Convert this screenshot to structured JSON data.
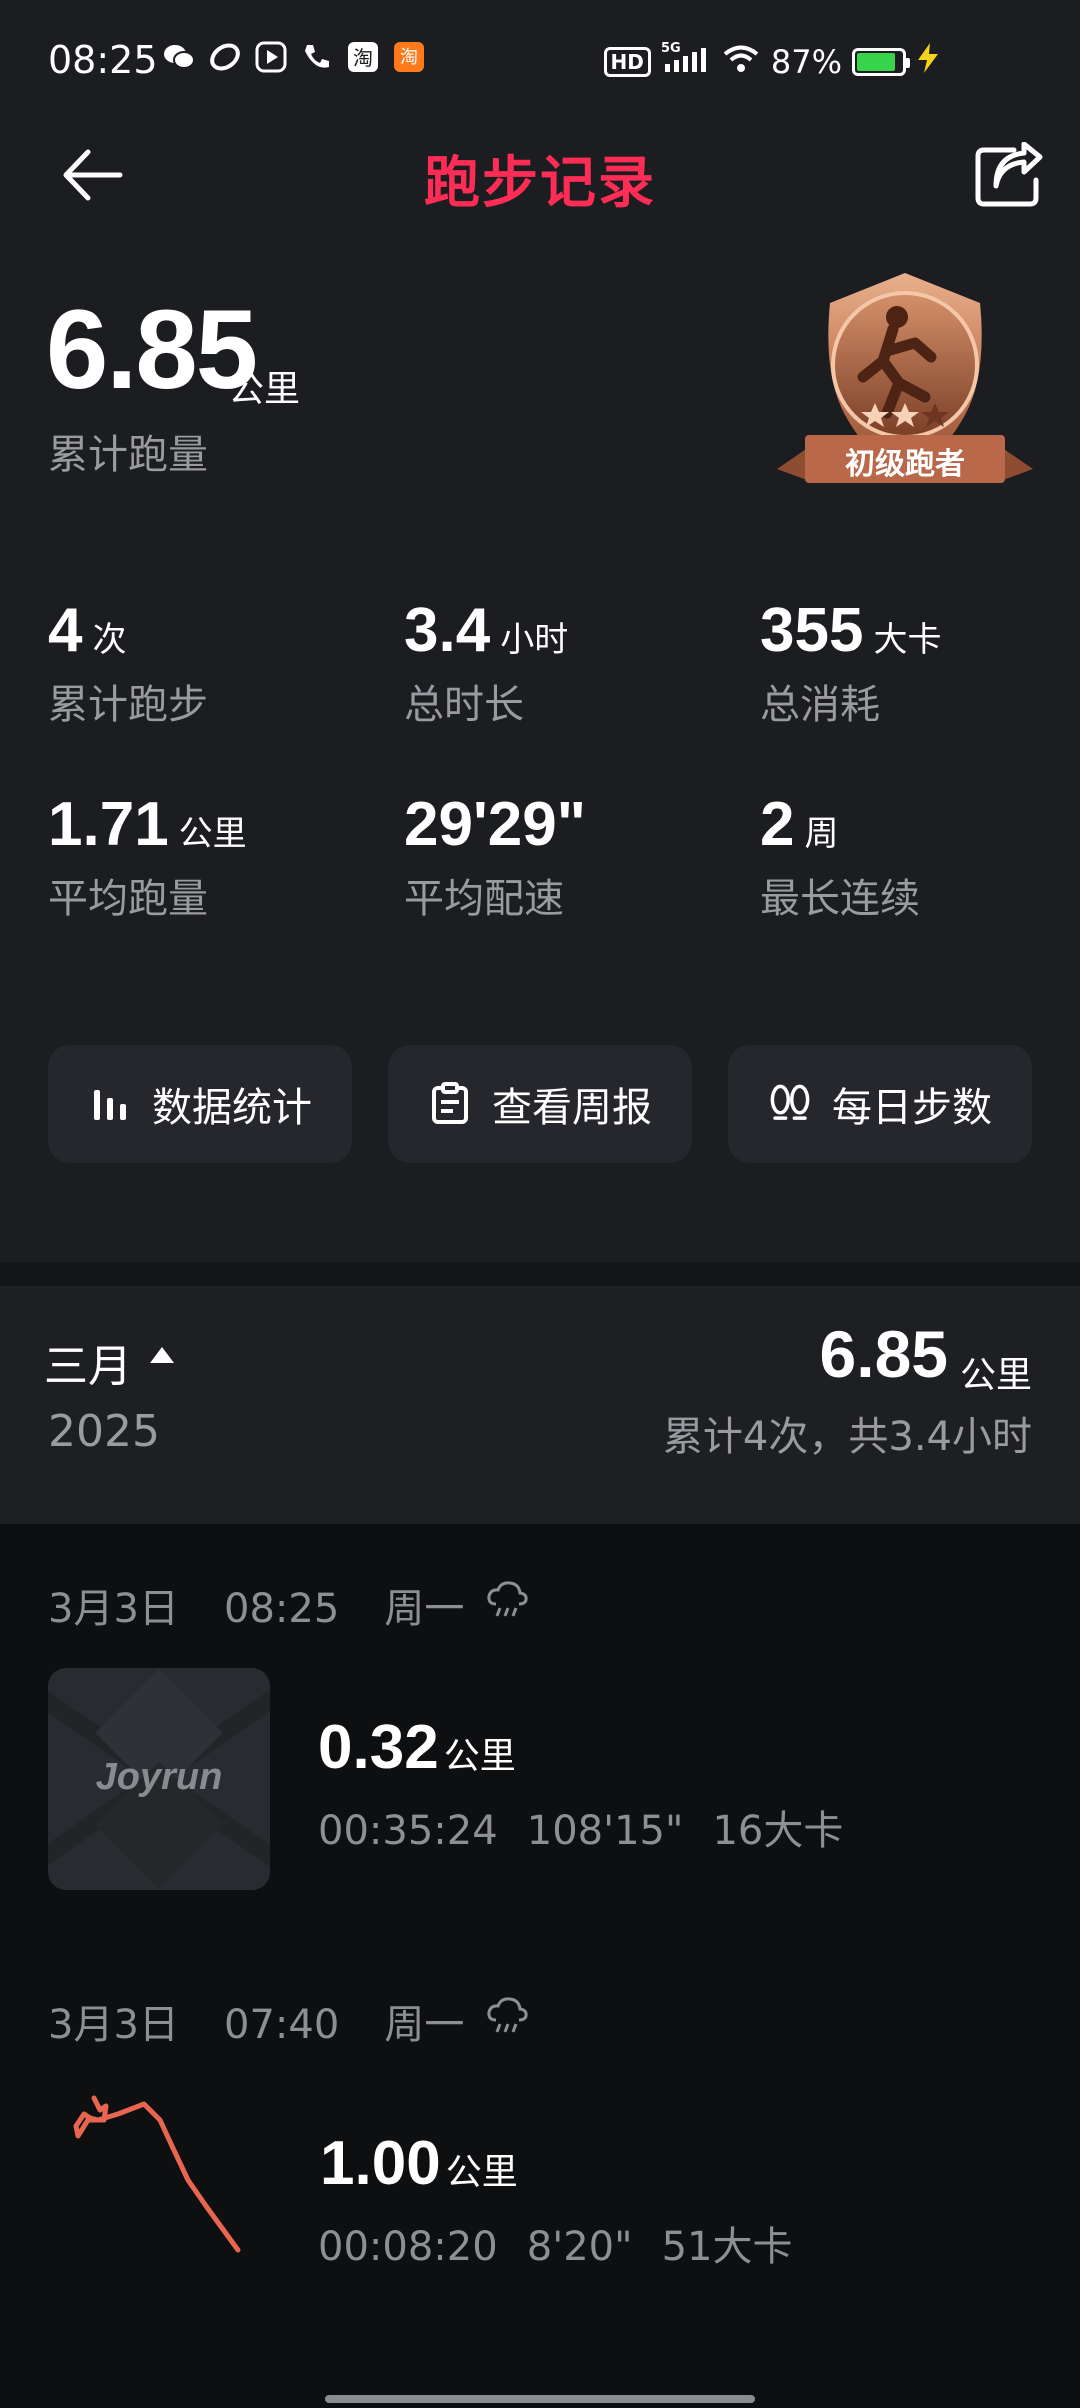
{
  "status": {
    "time": "08:25",
    "battery": "87%",
    "network": "5G",
    "hd": "HD",
    "icons": [
      "wechat-icon",
      "app-icon",
      "video-icon",
      "phone-icon",
      "taobao-icon",
      "taobao-lite-icon"
    ],
    "battery_color": "#37d34a"
  },
  "header": {
    "title": "跑步记录",
    "title_color": "#ff2d55"
  },
  "summary": {
    "total_value": "6.85",
    "total_unit": "公里",
    "total_label": "累计跑量",
    "badge_label": "初级跑者"
  },
  "stats": [
    {
      "value": "4",
      "unit": "次",
      "label": "累计跑步"
    },
    {
      "value": "3.4",
      "unit": "小时",
      "label": "总时长"
    },
    {
      "value": "355",
      "unit": "大卡",
      "label": "总消耗"
    },
    {
      "value": "1.71",
      "unit": "公里",
      "label": "平均跑量"
    },
    {
      "value": "29'29\"",
      "unit": "",
      "label": "平均配速"
    },
    {
      "value": "2",
      "unit": "周",
      "label": "最长连续"
    }
  ],
  "actions": [
    {
      "label": "数据统计",
      "icon": "bar-chart-icon"
    },
    {
      "label": "查看周报",
      "icon": "clipboard-icon"
    },
    {
      "label": "每日步数",
      "icon": "footprint-icon"
    }
  ],
  "month": {
    "name": "三月",
    "year": "2025",
    "km": "6.85",
    "km_unit": "公里",
    "summary": "累计4次，共3.4小时"
  },
  "records": [
    {
      "date": "3月3日",
      "time": "08:25",
      "weekday": "周一",
      "weather_icon": "rain-cloud-icon",
      "thumb_text": "Joyrun",
      "distance": "0.32",
      "unit": "公里",
      "duration": "00:35:24",
      "pace": "108'15\"",
      "calories": "16大卡"
    },
    {
      "date": "3月3日",
      "time": "07:40",
      "weekday": "周一",
      "weather_icon": "rain-cloud-icon",
      "route_color": "#e8664f",
      "distance": "1.00",
      "unit": "公里",
      "duration": "00:08:20",
      "pace": "8'20\"",
      "calories": "51大卡"
    }
  ]
}
